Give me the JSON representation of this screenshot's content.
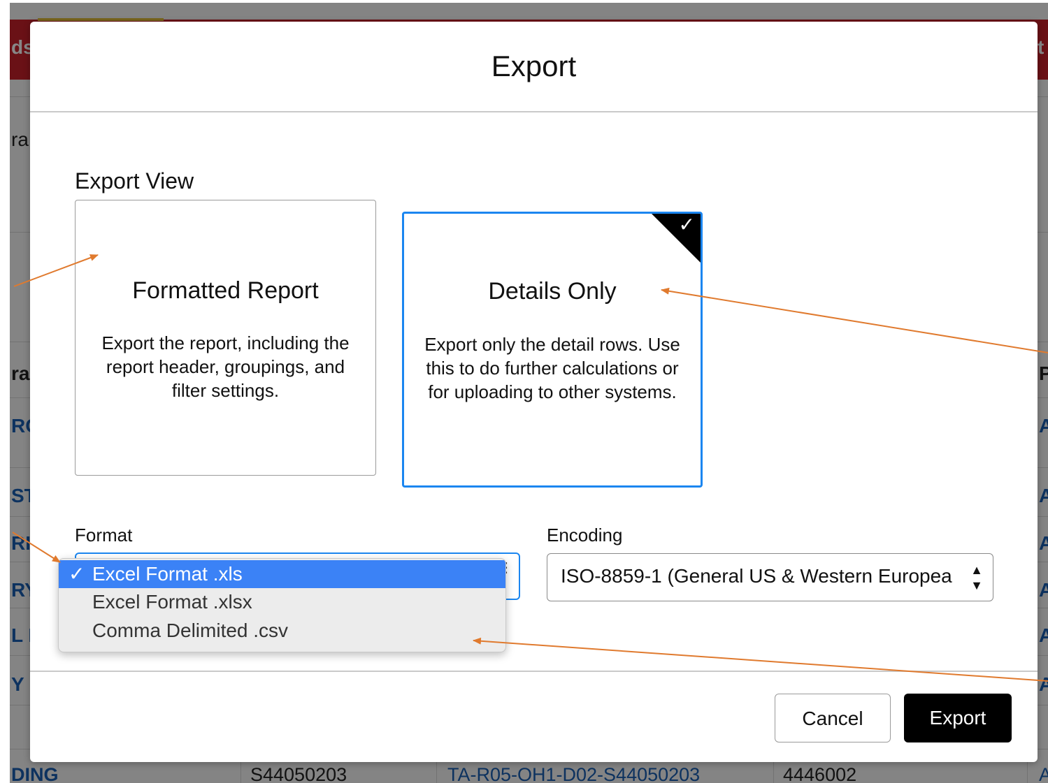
{
  "background": {
    "fragments": {
      "top_left": "ds",
      "top_right": "t",
      "row1": "ra",
      "row2": "ra",
      "row3": "RO",
      "row4": "ST",
      "row5": "RI",
      "row6": "RY",
      "row7": "L LI",
      "row8": "Y",
      "row_bottom_left": "DING",
      "right_col_p": "P",
      "right_col_a1": "A",
      "right_col_a2": "A",
      "right_col_a3": "A",
      "right_col_a4": "A",
      "right_col_a5": "A",
      "right_col_a6": "A",
      "right_col_a7": "A"
    },
    "bottom_row": {
      "cell_1": "S44050203",
      "cell_2": "TA-R05-OH1-D02-S44050203",
      "cell_3": "4446002",
      "cell_4": "A"
    }
  },
  "modal": {
    "title": "Export",
    "section_label": "Export View",
    "cards": [
      {
        "title": "Formatted Report",
        "description": "Export the report, including the report header, groupings, and filter settings.",
        "selected": false
      },
      {
        "title": "Details Only",
        "description": "Export only the detail rows. Use this to do further calculations or for uploading to other systems.",
        "selected": true
      }
    ],
    "format": {
      "label": "Format",
      "options": [
        "Excel Format .xls",
        "Excel Format .xlsx",
        "Comma Delimited .csv"
      ],
      "selected_index": 0
    },
    "encoding": {
      "label": "Encoding",
      "value": "ISO-8859-1 (General US & Western Europea"
    },
    "buttons": {
      "cancel": "Cancel",
      "export": "Export"
    }
  },
  "icons": {
    "check": "✓",
    "select_arrows": "▲▼"
  },
  "colors": {
    "selected_border": "#1b86f0",
    "option_highlight": "#3b82f6",
    "annotation_arrow": "#e07a2e",
    "header_red": "#c9202a"
  }
}
